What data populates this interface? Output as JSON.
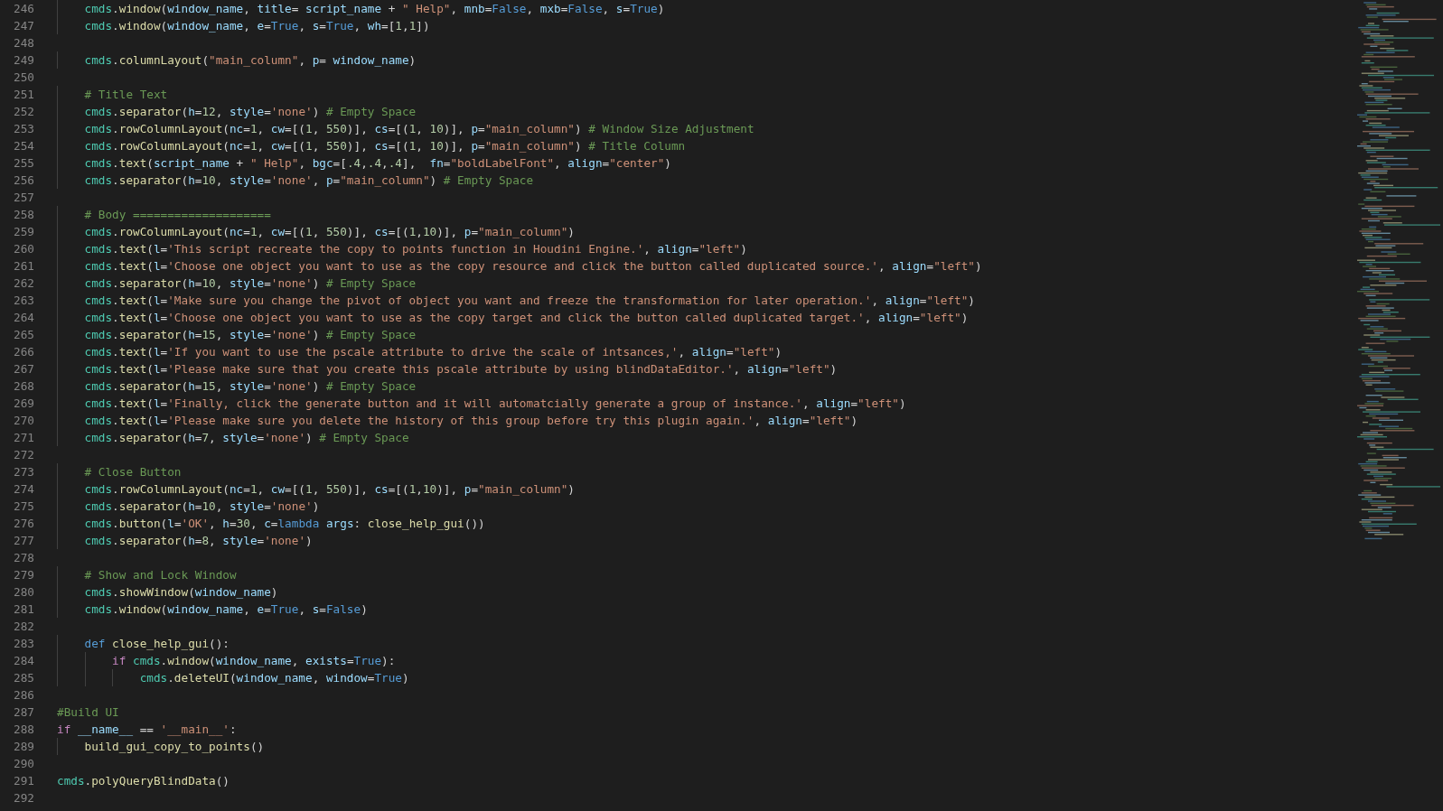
{
  "editor": {
    "lines": [
      {
        "number": "246",
        "tokens": [
          {
            "text": "    cmds",
            "kind": "mod"
          },
          {
            "text": ".",
            "kind": "pun"
          },
          {
            "text": "window",
            "kind": "fn"
          },
          {
            "text": "(",
            "kind": "pun"
          },
          {
            "text": "window_name",
            "kind": "var"
          },
          {
            "text": ", ",
            "kind": "pun"
          },
          {
            "text": "title",
            "kind": "var"
          },
          {
            "text": "= ",
            "kind": "pun"
          },
          {
            "text": "script_name",
            "kind": "var"
          },
          {
            "text": " + ",
            "kind": "pun"
          },
          {
            "text": "\" Help\"",
            "kind": "str"
          },
          {
            "text": ", ",
            "kind": "pun"
          },
          {
            "text": "mnb",
            "kind": "var"
          },
          {
            "text": "=",
            "kind": "pun"
          },
          {
            "text": "False",
            "kind": "const"
          },
          {
            "text": ", ",
            "kind": "pun"
          },
          {
            "text": "mxb",
            "kind": "var"
          },
          {
            "text": "=",
            "kind": "pun"
          },
          {
            "text": "False",
            "kind": "const"
          },
          {
            "text": ", ",
            "kind": "pun"
          },
          {
            "text": "s",
            "kind": "var"
          },
          {
            "text": "=",
            "kind": "pun"
          },
          {
            "text": "True",
            "kind": "const"
          },
          {
            "text": ")",
            "kind": "pun"
          }
        ]
      },
      {
        "number": "247",
        "tokens": [
          {
            "text": "    cmds",
            "kind": "mod"
          },
          {
            "text": ".",
            "kind": "pun"
          },
          {
            "text": "window",
            "kind": "fn"
          },
          {
            "text": "(",
            "kind": "pun"
          },
          {
            "text": "window_name",
            "kind": "var"
          },
          {
            "text": ", ",
            "kind": "pun"
          },
          {
            "text": "e",
            "kind": "var"
          },
          {
            "text": "=",
            "kind": "pun"
          },
          {
            "text": "True",
            "kind": "const"
          },
          {
            "text": ", ",
            "kind": "pun"
          },
          {
            "text": "s",
            "kind": "var"
          },
          {
            "text": "=",
            "kind": "pun"
          },
          {
            "text": "True",
            "kind": "const"
          },
          {
            "text": ", ",
            "kind": "pun"
          },
          {
            "text": "wh",
            "kind": "var"
          },
          {
            "text": "=[",
            "kind": "pun"
          },
          {
            "text": "1",
            "kind": "num"
          },
          {
            "text": ",",
            "kind": "pun"
          },
          {
            "text": "1",
            "kind": "num"
          },
          {
            "text": "])",
            "kind": "pun"
          }
        ]
      },
      {
        "number": "248"
      },
      {
        "number": "249",
        "tokens": [
          {
            "text": "    cmds",
            "kind": "mod"
          },
          {
            "text": ".",
            "kind": "pun"
          },
          {
            "text": "columnLayout",
            "kind": "fn"
          },
          {
            "text": "(",
            "kind": "pun"
          },
          {
            "text": "\"main_column\"",
            "kind": "str"
          },
          {
            "text": ", ",
            "kind": "pun"
          },
          {
            "text": "p",
            "kind": "var"
          },
          {
            "text": "= ",
            "kind": "pun"
          },
          {
            "text": "window_name",
            "kind": "var"
          },
          {
            "text": ")",
            "kind": "pun"
          }
        ]
      },
      {
        "number": "250"
      },
      {
        "number": "251",
        "tokens": [
          {
            "text": "    # Title Text",
            "kind": "cmt"
          }
        ]
      },
      {
        "number": "252",
        "tokens": [
          {
            "text": "    cmds",
            "kind": "mod"
          },
          {
            "text": ".",
            "kind": "pun"
          },
          {
            "text": "separator",
            "kind": "fn"
          },
          {
            "text": "(",
            "kind": "pun"
          },
          {
            "text": "h",
            "kind": "var"
          },
          {
            "text": "=",
            "kind": "pun"
          },
          {
            "text": "12",
            "kind": "num"
          },
          {
            "text": ", ",
            "kind": "pun"
          },
          {
            "text": "style",
            "kind": "var"
          },
          {
            "text": "=",
            "kind": "pun"
          },
          {
            "text": "'none'",
            "kind": "str"
          },
          {
            "text": ") ",
            "kind": "pun"
          },
          {
            "text": "# Empty Space",
            "kind": "cmt"
          }
        ]
      },
      {
        "number": "253",
        "tokens": [
          {
            "text": "    cmds",
            "kind": "mod"
          },
          {
            "text": ".",
            "kind": "pun"
          },
          {
            "text": "rowColumnLayout",
            "kind": "fn"
          },
          {
            "text": "(",
            "kind": "pun"
          },
          {
            "text": "nc",
            "kind": "var"
          },
          {
            "text": "=",
            "kind": "pun"
          },
          {
            "text": "1",
            "kind": "num"
          },
          {
            "text": ", ",
            "kind": "pun"
          },
          {
            "text": "cw",
            "kind": "var"
          },
          {
            "text": "=[(",
            "kind": "pun"
          },
          {
            "text": "1",
            "kind": "num"
          },
          {
            "text": ", ",
            "kind": "pun"
          },
          {
            "text": "550",
            "kind": "num"
          },
          {
            "text": ")], ",
            "kind": "pun"
          },
          {
            "text": "cs",
            "kind": "var"
          },
          {
            "text": "=[(",
            "kind": "pun"
          },
          {
            "text": "1",
            "kind": "num"
          },
          {
            "text": ", ",
            "kind": "pun"
          },
          {
            "text": "10",
            "kind": "num"
          },
          {
            "text": ")], ",
            "kind": "pun"
          },
          {
            "text": "p",
            "kind": "var"
          },
          {
            "text": "=",
            "kind": "pun"
          },
          {
            "text": "\"main_column\"",
            "kind": "str"
          },
          {
            "text": ") ",
            "kind": "pun"
          },
          {
            "text": "# Window Size Adjustment",
            "kind": "cmt"
          }
        ]
      },
      {
        "number": "254",
        "tokens": [
          {
            "text": "    cmds",
            "kind": "mod"
          },
          {
            "text": ".",
            "kind": "pun"
          },
          {
            "text": "rowColumnLayout",
            "kind": "fn"
          },
          {
            "text": "(",
            "kind": "pun"
          },
          {
            "text": "nc",
            "kind": "var"
          },
          {
            "text": "=",
            "kind": "pun"
          },
          {
            "text": "1",
            "kind": "num"
          },
          {
            "text": ", ",
            "kind": "pun"
          },
          {
            "text": "cw",
            "kind": "var"
          },
          {
            "text": "=[(",
            "kind": "pun"
          },
          {
            "text": "1",
            "kind": "num"
          },
          {
            "text": ", ",
            "kind": "pun"
          },
          {
            "text": "550",
            "kind": "num"
          },
          {
            "text": ")], ",
            "kind": "pun"
          },
          {
            "text": "cs",
            "kind": "var"
          },
          {
            "text": "=[(",
            "kind": "pun"
          },
          {
            "text": "1",
            "kind": "num"
          },
          {
            "text": ", ",
            "kind": "pun"
          },
          {
            "text": "10",
            "kind": "num"
          },
          {
            "text": ")], ",
            "kind": "pun"
          },
          {
            "text": "p",
            "kind": "var"
          },
          {
            "text": "=",
            "kind": "pun"
          },
          {
            "text": "\"main_column\"",
            "kind": "str"
          },
          {
            "text": ") ",
            "kind": "pun"
          },
          {
            "text": "# Title Column",
            "kind": "cmt"
          }
        ]
      },
      {
        "number": "255",
        "tokens": [
          {
            "text": "    cmds",
            "kind": "mod"
          },
          {
            "text": ".",
            "kind": "pun"
          },
          {
            "text": "text",
            "kind": "fn"
          },
          {
            "text": "(",
            "kind": "pun"
          },
          {
            "text": "script_name",
            "kind": "var"
          },
          {
            "text": " + ",
            "kind": "pun"
          },
          {
            "text": "\" Help\"",
            "kind": "str"
          },
          {
            "text": ", ",
            "kind": "pun"
          },
          {
            "text": "bgc",
            "kind": "var"
          },
          {
            "text": "=[",
            "kind": "pun"
          },
          {
            "text": ".4",
            "kind": "num"
          },
          {
            "text": ",",
            "kind": "pun"
          },
          {
            "text": ".4",
            "kind": "num"
          },
          {
            "text": ",",
            "kind": "pun"
          },
          {
            "text": ".4",
            "kind": "num"
          },
          {
            "text": "],  ",
            "kind": "pun"
          },
          {
            "text": "fn",
            "kind": "var"
          },
          {
            "text": "=",
            "kind": "pun"
          },
          {
            "text": "\"boldLabelFont\"",
            "kind": "str"
          },
          {
            "text": ", ",
            "kind": "pun"
          },
          {
            "text": "align",
            "kind": "var"
          },
          {
            "text": "=",
            "kind": "pun"
          },
          {
            "text": "\"center\"",
            "kind": "str"
          },
          {
            "text": ")",
            "kind": "pun"
          }
        ]
      },
      {
        "number": "256",
        "tokens": [
          {
            "text": "    cmds",
            "kind": "mod"
          },
          {
            "text": ".",
            "kind": "pun"
          },
          {
            "text": "separator",
            "kind": "fn"
          },
          {
            "text": "(",
            "kind": "pun"
          },
          {
            "text": "h",
            "kind": "var"
          },
          {
            "text": "=",
            "kind": "pun"
          },
          {
            "text": "10",
            "kind": "num"
          },
          {
            "text": ", ",
            "kind": "pun"
          },
          {
            "text": "style",
            "kind": "var"
          },
          {
            "text": "=",
            "kind": "pun"
          },
          {
            "text": "'none'",
            "kind": "str"
          },
          {
            "text": ", ",
            "kind": "pun"
          },
          {
            "text": "p",
            "kind": "var"
          },
          {
            "text": "=",
            "kind": "pun"
          },
          {
            "text": "\"main_column\"",
            "kind": "str"
          },
          {
            "text": ") ",
            "kind": "pun"
          },
          {
            "text": "# Empty Space",
            "kind": "cmt"
          }
        ]
      },
      {
        "number": "257"
      },
      {
        "number": "258",
        "tokens": [
          {
            "text": "    # Body ====================",
            "kind": "cmt"
          }
        ]
      },
      {
        "number": "259",
        "tokens": [
          {
            "text": "    cmds",
            "kind": "mod"
          },
          {
            "text": ".",
            "kind": "pun"
          },
          {
            "text": "rowColumnLayout",
            "kind": "fn"
          },
          {
            "text": "(",
            "kind": "pun"
          },
          {
            "text": "nc",
            "kind": "var"
          },
          {
            "text": "=",
            "kind": "pun"
          },
          {
            "text": "1",
            "kind": "num"
          },
          {
            "text": ", ",
            "kind": "pun"
          },
          {
            "text": "cw",
            "kind": "var"
          },
          {
            "text": "=[(",
            "kind": "pun"
          },
          {
            "text": "1",
            "kind": "num"
          },
          {
            "text": ", ",
            "kind": "pun"
          },
          {
            "text": "550",
            "kind": "num"
          },
          {
            "text": ")], ",
            "kind": "pun"
          },
          {
            "text": "cs",
            "kind": "var"
          },
          {
            "text": "=[(",
            "kind": "pun"
          },
          {
            "text": "1",
            "kind": "num"
          },
          {
            "text": ",",
            "kind": "pun"
          },
          {
            "text": "10",
            "kind": "num"
          },
          {
            "text": ")], ",
            "kind": "pun"
          },
          {
            "text": "p",
            "kind": "var"
          },
          {
            "text": "=",
            "kind": "pun"
          },
          {
            "text": "\"main_column\"",
            "kind": "str"
          },
          {
            "text": ")",
            "kind": "pun"
          }
        ]
      },
      {
        "number": "260",
        "tokens": [
          {
            "text": "    cmds",
            "kind": "mod"
          },
          {
            "text": ".",
            "kind": "pun"
          },
          {
            "text": "text",
            "kind": "fn"
          },
          {
            "text": "(",
            "kind": "pun"
          },
          {
            "text": "l",
            "kind": "var"
          },
          {
            "text": "=",
            "kind": "pun"
          },
          {
            "text": "'This script recreate the copy to points function in Houdini Engine.'",
            "kind": "str"
          },
          {
            "text": ", ",
            "kind": "pun"
          },
          {
            "text": "align",
            "kind": "var"
          },
          {
            "text": "=",
            "kind": "pun"
          },
          {
            "text": "\"left\"",
            "kind": "str"
          },
          {
            "text": ")",
            "kind": "pun"
          }
        ]
      },
      {
        "number": "261",
        "tokens": [
          {
            "text": "    cmds",
            "kind": "mod"
          },
          {
            "text": ".",
            "kind": "pun"
          },
          {
            "text": "text",
            "kind": "fn"
          },
          {
            "text": "(",
            "kind": "pun"
          },
          {
            "text": "l",
            "kind": "var"
          },
          {
            "text": "=",
            "kind": "pun"
          },
          {
            "text": "'Choose one object you want to use as the copy resource and click the button called duplicated source.'",
            "kind": "str"
          },
          {
            "text": ", ",
            "kind": "pun"
          },
          {
            "text": "align",
            "kind": "var"
          },
          {
            "text": "=",
            "kind": "pun"
          },
          {
            "text": "\"left\"",
            "kind": "str"
          },
          {
            "text": ")",
            "kind": "pun"
          }
        ]
      },
      {
        "number": "262",
        "tokens": [
          {
            "text": "    cmds",
            "kind": "mod"
          },
          {
            "text": ".",
            "kind": "pun"
          },
          {
            "text": "separator",
            "kind": "fn"
          },
          {
            "text": "(",
            "kind": "pun"
          },
          {
            "text": "h",
            "kind": "var"
          },
          {
            "text": "=",
            "kind": "pun"
          },
          {
            "text": "10",
            "kind": "num"
          },
          {
            "text": ", ",
            "kind": "pun"
          },
          {
            "text": "style",
            "kind": "var"
          },
          {
            "text": "=",
            "kind": "pun"
          },
          {
            "text": "'none'",
            "kind": "str"
          },
          {
            "text": ") ",
            "kind": "pun"
          },
          {
            "text": "# Empty Space",
            "kind": "cmt"
          }
        ]
      },
      {
        "number": "263",
        "tokens": [
          {
            "text": "    cmds",
            "kind": "mod"
          },
          {
            "text": ".",
            "kind": "pun"
          },
          {
            "text": "text",
            "kind": "fn"
          },
          {
            "text": "(",
            "kind": "pun"
          },
          {
            "text": "l",
            "kind": "var"
          },
          {
            "text": "=",
            "kind": "pun"
          },
          {
            "text": "'Make sure you change the pivot of object you want and freeze the transformation for later operation.'",
            "kind": "str"
          },
          {
            "text": ", ",
            "kind": "pun"
          },
          {
            "text": "align",
            "kind": "var"
          },
          {
            "text": "=",
            "kind": "pun"
          },
          {
            "text": "\"left\"",
            "kind": "str"
          },
          {
            "text": ")",
            "kind": "pun"
          }
        ]
      },
      {
        "number": "264",
        "tokens": [
          {
            "text": "    cmds",
            "kind": "mod"
          },
          {
            "text": ".",
            "kind": "pun"
          },
          {
            "text": "text",
            "kind": "fn"
          },
          {
            "text": "(",
            "kind": "pun"
          },
          {
            "text": "l",
            "kind": "var"
          },
          {
            "text": "=",
            "kind": "pun"
          },
          {
            "text": "'Choose one object you want to use as the copy target and click the button called duplicated target.'",
            "kind": "str"
          },
          {
            "text": ", ",
            "kind": "pun"
          },
          {
            "text": "align",
            "kind": "var"
          },
          {
            "text": "=",
            "kind": "pun"
          },
          {
            "text": "\"left\"",
            "kind": "str"
          },
          {
            "text": ")",
            "kind": "pun"
          }
        ]
      },
      {
        "number": "265",
        "tokens": [
          {
            "text": "    cmds",
            "kind": "mod"
          },
          {
            "text": ".",
            "kind": "pun"
          },
          {
            "text": "separator",
            "kind": "fn"
          },
          {
            "text": "(",
            "kind": "pun"
          },
          {
            "text": "h",
            "kind": "var"
          },
          {
            "text": "=",
            "kind": "pun"
          },
          {
            "text": "15",
            "kind": "num"
          },
          {
            "text": ", ",
            "kind": "pun"
          },
          {
            "text": "style",
            "kind": "var"
          },
          {
            "text": "=",
            "kind": "pun"
          },
          {
            "text": "'none'",
            "kind": "str"
          },
          {
            "text": ") ",
            "kind": "pun"
          },
          {
            "text": "# Empty Space",
            "kind": "cmt"
          }
        ]
      },
      {
        "number": "266",
        "tokens": [
          {
            "text": "    cmds",
            "kind": "mod"
          },
          {
            "text": ".",
            "kind": "pun"
          },
          {
            "text": "text",
            "kind": "fn"
          },
          {
            "text": "(",
            "kind": "pun"
          },
          {
            "text": "l",
            "kind": "var"
          },
          {
            "text": "=",
            "kind": "pun"
          },
          {
            "text": "'If you want to use the pscale attribute to drive the scale of intsances,'",
            "kind": "str"
          },
          {
            "text": ", ",
            "kind": "pun"
          },
          {
            "text": "align",
            "kind": "var"
          },
          {
            "text": "=",
            "kind": "pun"
          },
          {
            "text": "\"left\"",
            "kind": "str"
          },
          {
            "text": ")",
            "kind": "pun"
          }
        ]
      },
      {
        "number": "267",
        "tokens": [
          {
            "text": "    cmds",
            "kind": "mod"
          },
          {
            "text": ".",
            "kind": "pun"
          },
          {
            "text": "text",
            "kind": "fn"
          },
          {
            "text": "(",
            "kind": "pun"
          },
          {
            "text": "l",
            "kind": "var"
          },
          {
            "text": "=",
            "kind": "pun"
          },
          {
            "text": "'Please make sure that you create this pscale attribute by using blindDataEditor.'",
            "kind": "str"
          },
          {
            "text": ", ",
            "kind": "pun"
          },
          {
            "text": "align",
            "kind": "var"
          },
          {
            "text": "=",
            "kind": "pun"
          },
          {
            "text": "\"left\"",
            "kind": "str"
          },
          {
            "text": ")",
            "kind": "pun"
          }
        ]
      },
      {
        "number": "268",
        "tokens": [
          {
            "text": "    cmds",
            "kind": "mod"
          },
          {
            "text": ".",
            "kind": "pun"
          },
          {
            "text": "separator",
            "kind": "fn"
          },
          {
            "text": "(",
            "kind": "pun"
          },
          {
            "text": "h",
            "kind": "var"
          },
          {
            "text": "=",
            "kind": "pun"
          },
          {
            "text": "15",
            "kind": "num"
          },
          {
            "text": ", ",
            "kind": "pun"
          },
          {
            "text": "style",
            "kind": "var"
          },
          {
            "text": "=",
            "kind": "pun"
          },
          {
            "text": "'none'",
            "kind": "str"
          },
          {
            "text": ") ",
            "kind": "pun"
          },
          {
            "text": "# Empty Space",
            "kind": "cmt"
          }
        ]
      },
      {
        "number": "269",
        "tokens": [
          {
            "text": "    cmds",
            "kind": "mod"
          },
          {
            "text": ".",
            "kind": "pun"
          },
          {
            "text": "text",
            "kind": "fn"
          },
          {
            "text": "(",
            "kind": "pun"
          },
          {
            "text": "l",
            "kind": "var"
          },
          {
            "text": "=",
            "kind": "pun"
          },
          {
            "text": "'Finally, click the generate button and it will automatcially generate a group of instance.'",
            "kind": "str"
          },
          {
            "text": ", ",
            "kind": "pun"
          },
          {
            "text": "align",
            "kind": "var"
          },
          {
            "text": "=",
            "kind": "pun"
          },
          {
            "text": "\"left\"",
            "kind": "str"
          },
          {
            "text": ")",
            "kind": "pun"
          }
        ]
      },
      {
        "number": "270",
        "tokens": [
          {
            "text": "    cmds",
            "kind": "mod"
          },
          {
            "text": ".",
            "kind": "pun"
          },
          {
            "text": "text",
            "kind": "fn"
          },
          {
            "text": "(",
            "kind": "pun"
          },
          {
            "text": "l",
            "kind": "var"
          },
          {
            "text": "=",
            "kind": "pun"
          },
          {
            "text": "'Please make sure you delete the history of this group before try this plugin again.'",
            "kind": "str"
          },
          {
            "text": ", ",
            "kind": "pun"
          },
          {
            "text": "align",
            "kind": "var"
          },
          {
            "text": "=",
            "kind": "pun"
          },
          {
            "text": "\"left\"",
            "kind": "str"
          },
          {
            "text": ")",
            "kind": "pun"
          }
        ]
      },
      {
        "number": "271",
        "tokens": [
          {
            "text": "    cmds",
            "kind": "mod"
          },
          {
            "text": ".",
            "kind": "pun"
          },
          {
            "text": "separator",
            "kind": "fn"
          },
          {
            "text": "(",
            "kind": "pun"
          },
          {
            "text": "h",
            "kind": "var"
          },
          {
            "text": "=",
            "kind": "pun"
          },
          {
            "text": "7",
            "kind": "num"
          },
          {
            "text": ", ",
            "kind": "pun"
          },
          {
            "text": "style",
            "kind": "var"
          },
          {
            "text": "=",
            "kind": "pun"
          },
          {
            "text": "'none'",
            "kind": "str"
          },
          {
            "text": ") ",
            "kind": "pun"
          },
          {
            "text": "# Empty Space",
            "kind": "cmt"
          }
        ]
      },
      {
        "number": "272"
      },
      {
        "number": "273",
        "tokens": [
          {
            "text": "    # Close Button",
            "kind": "cmt"
          }
        ]
      },
      {
        "number": "274",
        "tokens": [
          {
            "text": "    cmds",
            "kind": "mod"
          },
          {
            "text": ".",
            "kind": "pun"
          },
          {
            "text": "rowColumnLayout",
            "kind": "fn"
          },
          {
            "text": "(",
            "kind": "pun"
          },
          {
            "text": "nc",
            "kind": "var"
          },
          {
            "text": "=",
            "kind": "pun"
          },
          {
            "text": "1",
            "kind": "num"
          },
          {
            "text": ", ",
            "kind": "pun"
          },
          {
            "text": "cw",
            "kind": "var"
          },
          {
            "text": "=[(",
            "kind": "pun"
          },
          {
            "text": "1",
            "kind": "num"
          },
          {
            "text": ", ",
            "kind": "pun"
          },
          {
            "text": "550",
            "kind": "num"
          },
          {
            "text": ")], ",
            "kind": "pun"
          },
          {
            "text": "cs",
            "kind": "var"
          },
          {
            "text": "=[(",
            "kind": "pun"
          },
          {
            "text": "1",
            "kind": "num"
          },
          {
            "text": ",",
            "kind": "pun"
          },
          {
            "text": "10",
            "kind": "num"
          },
          {
            "text": ")], ",
            "kind": "pun"
          },
          {
            "text": "p",
            "kind": "var"
          },
          {
            "text": "=",
            "kind": "pun"
          },
          {
            "text": "\"main_column\"",
            "kind": "str"
          },
          {
            "text": ")",
            "kind": "pun"
          }
        ]
      },
      {
        "number": "275",
        "tokens": [
          {
            "text": "    cmds",
            "kind": "mod"
          },
          {
            "text": ".",
            "kind": "pun"
          },
          {
            "text": "separator",
            "kind": "fn"
          },
          {
            "text": "(",
            "kind": "pun"
          },
          {
            "text": "h",
            "kind": "var"
          },
          {
            "text": "=",
            "kind": "pun"
          },
          {
            "text": "10",
            "kind": "num"
          },
          {
            "text": ", ",
            "kind": "pun"
          },
          {
            "text": "style",
            "kind": "var"
          },
          {
            "text": "=",
            "kind": "pun"
          },
          {
            "text": "'none'",
            "kind": "str"
          },
          {
            "text": ")",
            "kind": "pun"
          }
        ]
      },
      {
        "number": "276",
        "tokens": [
          {
            "text": "    cmds",
            "kind": "mod"
          },
          {
            "text": ".",
            "kind": "pun"
          },
          {
            "text": "button",
            "kind": "fn"
          },
          {
            "text": "(",
            "kind": "pun"
          },
          {
            "text": "l",
            "kind": "var"
          },
          {
            "text": "=",
            "kind": "pun"
          },
          {
            "text": "'OK'",
            "kind": "str"
          },
          {
            "text": ", ",
            "kind": "pun"
          },
          {
            "text": "h",
            "kind": "var"
          },
          {
            "text": "=",
            "kind": "pun"
          },
          {
            "text": "30",
            "kind": "num"
          },
          {
            "text": ", ",
            "kind": "pun"
          },
          {
            "text": "c",
            "kind": "var"
          },
          {
            "text": "=",
            "kind": "pun"
          },
          {
            "text": "lambda ",
            "kind": "const"
          },
          {
            "text": "args",
            "kind": "var"
          },
          {
            "text": ": ",
            "kind": "pun"
          },
          {
            "text": "close_help_gui",
            "kind": "fn"
          },
          {
            "text": "())",
            "kind": "pun"
          }
        ]
      },
      {
        "number": "277",
        "tokens": [
          {
            "text": "    cmds",
            "kind": "mod"
          },
          {
            "text": ".",
            "kind": "pun"
          },
          {
            "text": "separator",
            "kind": "fn"
          },
          {
            "text": "(",
            "kind": "pun"
          },
          {
            "text": "h",
            "kind": "var"
          },
          {
            "text": "=",
            "kind": "pun"
          },
          {
            "text": "8",
            "kind": "num"
          },
          {
            "text": ", ",
            "kind": "pun"
          },
          {
            "text": "style",
            "kind": "var"
          },
          {
            "text": "=",
            "kind": "pun"
          },
          {
            "text": "'none'",
            "kind": "str"
          },
          {
            "text": ")",
            "kind": "pun"
          }
        ]
      },
      {
        "number": "278"
      },
      {
        "number": "279",
        "tokens": [
          {
            "text": "    # Show and Lock Window",
            "kind": "cmt"
          }
        ]
      },
      {
        "number": "280",
        "tokens": [
          {
            "text": "    cmds",
            "kind": "mod"
          },
          {
            "text": ".",
            "kind": "pun"
          },
          {
            "text": "showWindow",
            "kind": "fn"
          },
          {
            "text": "(",
            "kind": "pun"
          },
          {
            "text": "window_name",
            "kind": "var"
          },
          {
            "text": ")",
            "kind": "pun"
          }
        ]
      },
      {
        "number": "281",
        "tokens": [
          {
            "text": "    cmds",
            "kind": "mod"
          },
          {
            "text": ".",
            "kind": "pun"
          },
          {
            "text": "window",
            "kind": "fn"
          },
          {
            "text": "(",
            "kind": "pun"
          },
          {
            "text": "window_name",
            "kind": "var"
          },
          {
            "text": ", ",
            "kind": "pun"
          },
          {
            "text": "e",
            "kind": "var"
          },
          {
            "text": "=",
            "kind": "pun"
          },
          {
            "text": "True",
            "kind": "const"
          },
          {
            "text": ", ",
            "kind": "pun"
          },
          {
            "text": "s",
            "kind": "var"
          },
          {
            "text": "=",
            "kind": "pun"
          },
          {
            "text": "False",
            "kind": "const"
          },
          {
            "text": ")",
            "kind": "pun"
          }
        ]
      },
      {
        "number": "282"
      },
      {
        "number": "283",
        "tokens": [
          {
            "text": "    def ",
            "kind": "const"
          },
          {
            "text": "close_help_gui",
            "kind": "fn"
          },
          {
            "text": "():",
            "kind": "pun"
          }
        ]
      },
      {
        "number": "284",
        "tokens": [
          {
            "text": "        if ",
            "kind": "kw"
          },
          {
            "text": "cmds",
            "kind": "mod"
          },
          {
            "text": ".",
            "kind": "pun"
          },
          {
            "text": "window",
            "kind": "fn"
          },
          {
            "text": "(",
            "kind": "pun"
          },
          {
            "text": "window_name",
            "kind": "var"
          },
          {
            "text": ", ",
            "kind": "pun"
          },
          {
            "text": "exists",
            "kind": "var"
          },
          {
            "text": "=",
            "kind": "pun"
          },
          {
            "text": "True",
            "kind": "const"
          },
          {
            "text": "):",
            "kind": "pun"
          }
        ]
      },
      {
        "number": "285",
        "tokens": [
          {
            "text": "            cmds",
            "kind": "mod"
          },
          {
            "text": ".",
            "kind": "pun"
          },
          {
            "text": "deleteUI",
            "kind": "fn"
          },
          {
            "text": "(",
            "kind": "pun"
          },
          {
            "text": "window_name",
            "kind": "var"
          },
          {
            "text": ", ",
            "kind": "pun"
          },
          {
            "text": "window",
            "kind": "var"
          },
          {
            "text": "=",
            "kind": "pun"
          },
          {
            "text": "True",
            "kind": "const"
          },
          {
            "text": ")",
            "kind": "pun"
          }
        ]
      },
      {
        "number": "286"
      },
      {
        "number": "287",
        "tokens": [
          {
            "text": "#Build UI",
            "kind": "cmt"
          }
        ]
      },
      {
        "number": "288",
        "tokens": [
          {
            "text": "if ",
            "kind": "kw"
          },
          {
            "text": "__name__",
            "kind": "var"
          },
          {
            "text": " == ",
            "kind": "pun"
          },
          {
            "text": "'__main__'",
            "kind": "str"
          },
          {
            "text": ":",
            "kind": "pun"
          }
        ]
      },
      {
        "number": "289",
        "tokens": [
          {
            "text": "    build_gui_copy_to_points",
            "kind": "fn"
          },
          {
            "text": "()",
            "kind": "pun"
          }
        ]
      },
      {
        "number": "290"
      },
      {
        "number": "291",
        "tokens": [
          {
            "text": "cmds",
            "kind": "mod"
          },
          {
            "text": ".",
            "kind": "pun"
          },
          {
            "text": "polyQueryBlindData",
            "kind": "fn"
          },
          {
            "text": "()",
            "kind": "pun"
          }
        ]
      },
      {
        "number": "292"
      }
    ]
  }
}
